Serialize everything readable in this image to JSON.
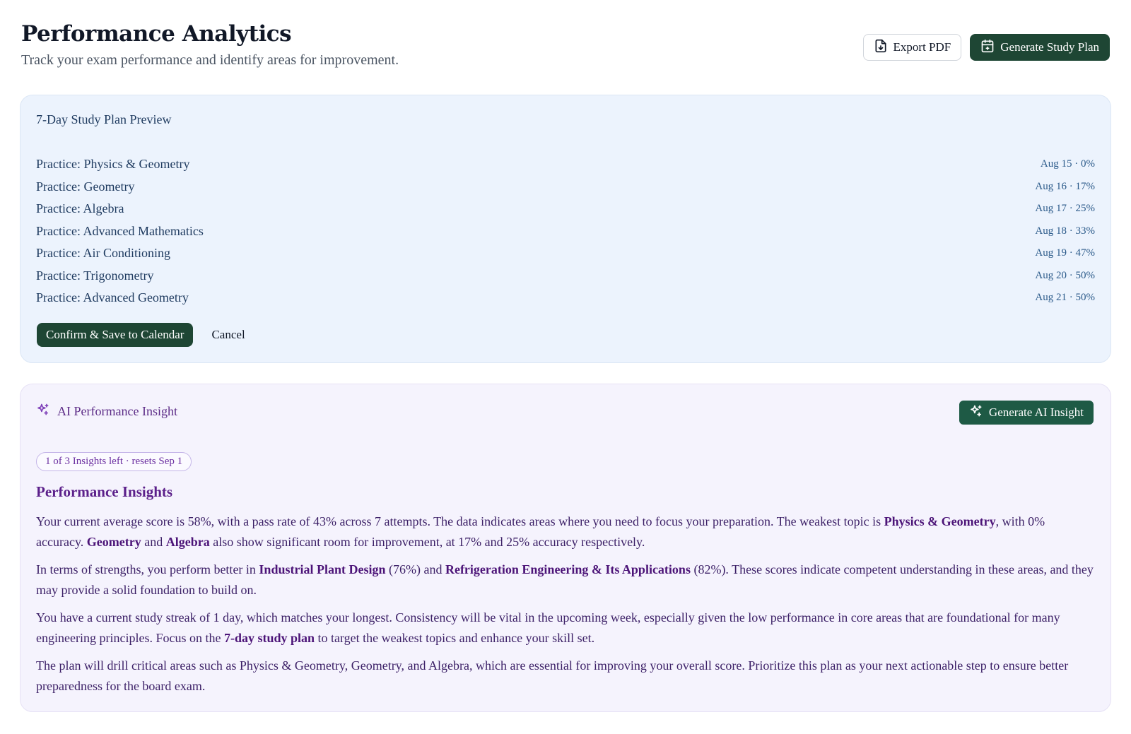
{
  "header": {
    "title": "Performance Analytics",
    "subtitle": "Track your exam performance and identify areas for improvement.",
    "export_label": "Export PDF",
    "generate_plan_label": "Generate Study Plan"
  },
  "plan": {
    "title": "7-Day Study Plan Preview",
    "items": [
      {
        "label": "Practice: Physics & Geometry",
        "meta": "Aug 15 · 0%"
      },
      {
        "label": "Practice: Geometry",
        "meta": "Aug 16 · 17%"
      },
      {
        "label": "Practice: Algebra",
        "meta": "Aug 17 · 25%"
      },
      {
        "label": "Practice: Advanced Mathematics",
        "meta": "Aug 18 · 33%"
      },
      {
        "label": "Practice: Air Conditioning",
        "meta": "Aug 19 · 47%"
      },
      {
        "label": "Practice: Trigonometry",
        "meta": "Aug 20 · 50%"
      },
      {
        "label": "Practice: Advanced Geometry",
        "meta": "Aug 21 · 50%"
      }
    ],
    "confirm_label": "Confirm & Save to Calendar",
    "cancel_label": "Cancel"
  },
  "insight": {
    "title": "AI Performance Insight",
    "generate_label": "Generate AI Insight",
    "quota": "1 of 3 Insights left · resets Sep 1",
    "heading": "Performance Insights",
    "paragraphs": [
      [
        {
          "t": "Your current average score is 58%, with a pass rate of 43% across 7 attempts. The data indicates areas where you need to focus your preparation. The weakest topic is "
        },
        {
          "b": "Physics & Geometry"
        },
        {
          "t": ", with 0% accuracy. "
        },
        {
          "b": "Geometry"
        },
        {
          "t": " and "
        },
        {
          "b": "Algebra"
        },
        {
          "t": " also show significant room for improvement, at 17% and 25% accuracy respectively."
        }
      ],
      [
        {
          "t": "In terms of strengths, you perform better in "
        },
        {
          "b": "Industrial Plant Design"
        },
        {
          "t": " (76%) and "
        },
        {
          "b": "Refrigeration Engineering & Its Applications"
        },
        {
          "t": " (82%). These scores indicate competent understanding in these areas, and they may provide a solid foundation to build on."
        }
      ],
      [
        {
          "t": "You have a current study streak of 1 day, which matches your longest. Consistency will be vital in the upcoming week, especially given the low performance in core areas that are foundational for many engineering principles. Focus on the "
        },
        {
          "b": "7-day study plan"
        },
        {
          "t": " to target the weakest topics and enhance your skill set."
        }
      ],
      [
        {
          "t": "The plan will drill critical areas such as Physics & Geometry, Geometry, and Algebra, which are essential for improving your overall score. Prioritize this plan as your next actionable step to ensure better preparedness for the board exam."
        }
      ]
    ]
  },
  "colors": {
    "primary_dark_green": "#1e4634",
    "plan_bg": "#ecf3fd",
    "insight_bg": "#f5f3fd",
    "insight_accent": "#5b1f8a"
  },
  "icons": {
    "export": "file-download-icon",
    "plan": "calendar-plus-icon",
    "sparkle": "sparkles-icon"
  }
}
